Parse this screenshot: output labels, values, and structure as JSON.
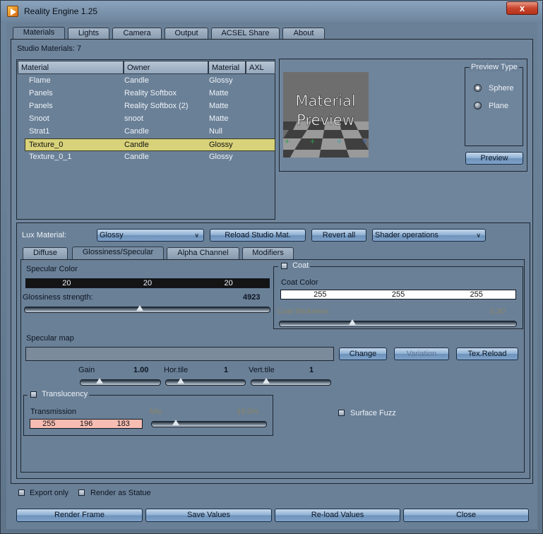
{
  "window": {
    "title": "Reality Engine 1.25",
    "close_glyph": "x"
  },
  "tabs": [
    "Materials",
    "Lights",
    "Camera",
    "Output",
    "ACSEL Share",
    "About"
  ],
  "studio_materials_label": "Studio Materials: 7",
  "table": {
    "headers": [
      "Material",
      "Owner",
      "Material",
      "AXL"
    ],
    "rows": [
      [
        "Flame",
        "Candle",
        "Glossy"
      ],
      [
        "Panels",
        "Reality Softbox",
        "Matte"
      ],
      [
        "Panels",
        "Reality Softbox (2)",
        "Matte"
      ],
      [
        "Snoot",
        "snoot",
        "Matte"
      ],
      [
        "Strat1",
        "Candle",
        "Null"
      ],
      [
        "Texture_0",
        "Candle",
        "Glossy"
      ],
      [
        "Texture_0_1",
        "Candle",
        "Glossy"
      ]
    ],
    "selected_index": 5
  },
  "preview": {
    "image_text_line1": "Material",
    "image_text_line2": "Preview",
    "type_title": "Preview Type",
    "options": [
      "Sphere",
      "Plane"
    ],
    "selected": "Sphere",
    "button": "Preview"
  },
  "lux": {
    "label": "Lux Material:",
    "value": "Glossy",
    "reload_button": "Reload Studio Mat.",
    "revert_button": "Revert all",
    "shader_ops": "Shader operations"
  },
  "subtabs": [
    "Diffuse",
    "Glossiness/Specular",
    "Alpha Channel",
    "Modifiers"
  ],
  "specular": {
    "label": "Specular Color",
    "rgb": [
      "20",
      "20",
      "20"
    ],
    "gloss_label": "Glossiness strength:",
    "gloss_value": "4923",
    "gloss_fraction": 0.47
  },
  "coat": {
    "title": "Coat",
    "color_label": "Coat Color",
    "rgb": [
      "255",
      "255",
      "255"
    ],
    "thickness_label": "Coat thickness:",
    "thickness_value": "0.30",
    "thickness_fraction": 0.3
  },
  "specmap": {
    "label": "Specular map",
    "change": "Change",
    "variation": "Variation",
    "texreload": "Tex.Reload",
    "gain_label": "Gain",
    "gain_value": "1.00",
    "htile_label": "Hor.tile",
    "htile_value": "1",
    "vtile_label": "Vert.tile",
    "vtile_value": "1"
  },
  "translucency": {
    "title": "Translucency",
    "transmission_label": "Transmission",
    "rgb": [
      "255",
      "196",
      "183"
    ],
    "mix_label": "Mix",
    "mix_value": "19.0%",
    "mix_fraction": 0.19,
    "surface_fuzz": "Surface Fuzz"
  },
  "bottom": {
    "export_only": "Export only",
    "render_statue": "Render as Statue",
    "buttons": [
      "Render Frame",
      "Save Values",
      "Re-load Values",
      "Close"
    ]
  },
  "colors": {
    "selected_row": "#d8d27a",
    "transmission": "#f7bdb3",
    "close_red": "#c9452d"
  }
}
